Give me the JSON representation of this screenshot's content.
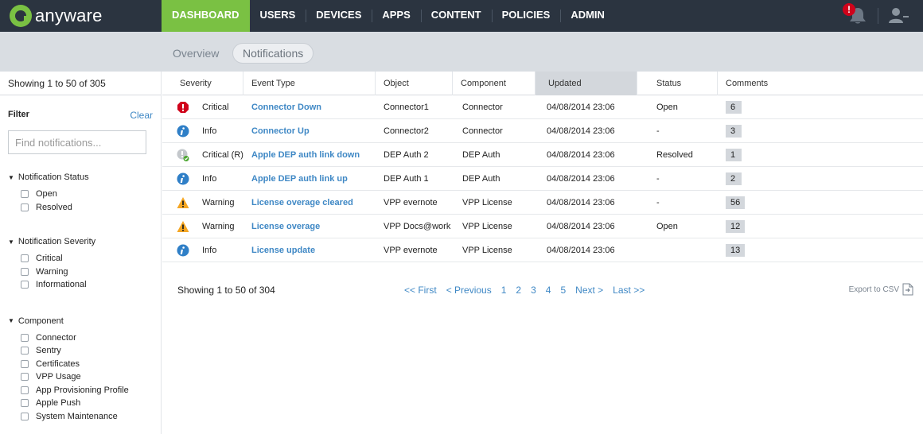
{
  "brand": {
    "name": "anyware"
  },
  "nav": [
    {
      "label": "DASHBOARD",
      "active": true
    },
    {
      "label": "USERS"
    },
    {
      "label": "DEVICES"
    },
    {
      "label": "APPS"
    },
    {
      "label": "CONTENT"
    },
    {
      "label": "POLICIES"
    },
    {
      "label": "ADMIN"
    }
  ],
  "alerts": {
    "badge": "!"
  },
  "subtabs": {
    "overview": "Overview",
    "notifications": "Notifications"
  },
  "sidebar": {
    "showing": "Showing 1 to 50 of 305",
    "filter_label": "Filter",
    "clear_label": "Clear",
    "search_placeholder": "Find notifications...",
    "groups": [
      {
        "title": "Notification Status",
        "options": [
          "Open",
          "Resolved"
        ]
      },
      {
        "title": "Notification Severity",
        "options": [
          "Critical",
          "Warning",
          "Informational"
        ]
      },
      {
        "title": "Component",
        "options": [
          "Connector",
          "Sentry",
          "Certificates",
          "VPP Usage",
          "App Provisioning Profile",
          "Apple Push",
          "System Maintenance"
        ]
      }
    ]
  },
  "table": {
    "headers": {
      "severity": "Severity",
      "event_type": "Event Type",
      "object": "Object",
      "component": "Component",
      "updated": "Updated",
      "status": "Status",
      "comments": "Comments"
    },
    "rows": [
      {
        "sev_icon": "critical",
        "severity": "Critical",
        "event": "Connector Down",
        "object": "Connector1",
        "component": "Connector",
        "updated": "04/08/2014 23:06",
        "status": "Open",
        "comments": "6"
      },
      {
        "sev_icon": "info",
        "severity": "Info",
        "event": "Connector Up",
        "object": "Connector2",
        "component": "Connector",
        "updated": "04/08/2014 23:06",
        "status": "-",
        "comments": "3"
      },
      {
        "sev_icon": "resolved",
        "severity": "Critical (R)",
        "event": "Apple DEP auth link down",
        "object": "DEP Auth 2",
        "component": "DEP Auth",
        "updated": "04/08/2014 23:06",
        "status": "Resolved",
        "comments": "1"
      },
      {
        "sev_icon": "info",
        "severity": "Info",
        "event": "Apple DEP auth link up",
        "object": "DEP Auth 1",
        "component": "DEP Auth",
        "updated": "04/08/2014 23:06",
        "status": "-",
        "comments": "2"
      },
      {
        "sev_icon": "warning",
        "severity": "Warning",
        "event": "License overage cleared",
        "object": "VPP evernote",
        "component": "VPP License",
        "updated": "04/08/2014 23:06",
        "status": "-",
        "comments": "56"
      },
      {
        "sev_icon": "warning",
        "severity": "Warning",
        "event": "License overage",
        "object": "VPP Docs@work",
        "component": "VPP License",
        "updated": "04/08/2014 23:06",
        "status": "Open",
        "comments": "12"
      },
      {
        "sev_icon": "info",
        "severity": "Info",
        "event": "License update",
        "object": "VPP evernote",
        "component": "VPP License",
        "updated": "04/08/2014 23:06",
        "status": "",
        "comments": "13"
      }
    ]
  },
  "footer": {
    "showing": "Showing 1 to 50 of 304",
    "pager": {
      "first": "<< First",
      "previous": "< Previous",
      "pages": [
        "1",
        "2",
        "3",
        "4",
        "5"
      ],
      "next": "Next >",
      "last": "Last >>"
    },
    "export_label": "Export to CSV"
  },
  "colors": {
    "topbar": "#2b3440",
    "accent": "#7ac143",
    "link": "#3f88c5",
    "critical": "#d0021b",
    "info": "#2f7fc7",
    "warning": "#f5a623"
  }
}
